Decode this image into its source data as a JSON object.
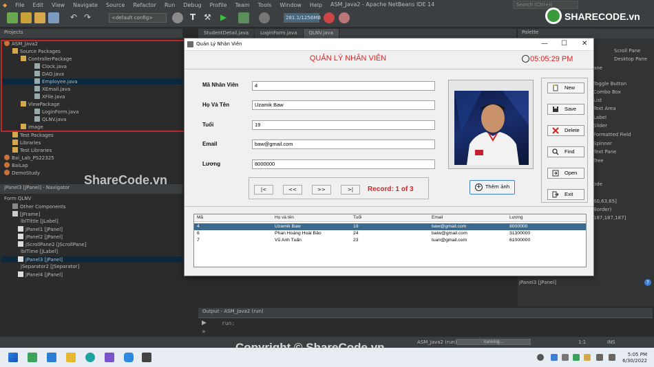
{
  "ide": {
    "title": "ASM_Java2 - Apache NetBeans IDE 14",
    "menu": [
      "File",
      "Edit",
      "View",
      "Navigate",
      "Source",
      "Refactor",
      "Run",
      "Debug",
      "Profile",
      "Team",
      "Tools",
      "Window",
      "Help"
    ],
    "search_placeholder": "Search (Ctrl+I)",
    "config": "<default config>",
    "memory": "281.1/1256MB",
    "projects_tab": "Projects",
    "project_tree": [
      "ASM_Java2",
      "Source Packages",
      "ControllerPackage",
      "Clock.java",
      "DAO.java",
      "Employee.java",
      "XEmail.java",
      "XFile.java",
      "ViewPackage",
      "LoginForm.java",
      "QLNV.java",
      "image",
      "Test Packages",
      "Libraries",
      "Test Libraries",
      "Bai_Lab_PS22325",
      "BaiLap",
      "DemoStudy"
    ],
    "navigator_tab": "jPanel3 [JPanel] - Navigator",
    "navigator_tree": [
      "Form QLNV",
      "Other Components",
      "[JFrame]",
      "lblTittle [JLabel]",
      "jPanel1 [JPanel]",
      "jPanel2 [JPanel]",
      "jScrollPane2 [JScrollPane]",
      "lblTime [JLabel]",
      "jPanel3 [JPanel]",
      "jSeparator2 [JSeparator]",
      "jPanel4 [JPanel]"
    ],
    "editor_tabs": [
      "StudentDetail.java",
      "LoginForm.java",
      "QLNV.java"
    ],
    "palette_tab": "Palette",
    "palette_items": [
      "Scroll Pane",
      "Desktop Pane",
      "ane",
      "Toggle Button",
      "Combo Box",
      "List",
      "Text Area",
      "Label",
      "Slider",
      "Formatted Field",
      "Spinner",
      "Text Pane",
      "Tree",
      "ode",
      "60,63,65]",
      "Border)",
      "187,187,187]",
      "jPanel3 [JPanel]"
    ],
    "output_tab": "Output - ASM_Java2 (run)",
    "output_text": "run:",
    "status_project": "ASM_Java2 (run)",
    "status_running": "running...",
    "status_pos": "1:1",
    "status_mode": "INS",
    "clock_time": "5:05 PM",
    "clock_date": "6/30/2022",
    "watermark_side": "ShareCode.vn",
    "watermark_bottom": "Copyright © ShareCode.vn",
    "logo_text": "SHARECODE.vn"
  },
  "app": {
    "window_title": "Quản Lý Nhân Viên",
    "heading": "QUẢN LÝ NHÂN VIÊN",
    "time": "05:05:29 PM",
    "fields": [
      {
        "label": "Mã Nhân Viên",
        "value": "4"
      },
      {
        "label": "Họ Và Tên",
        "value": "Uzamik Baw"
      },
      {
        "label": "Tuổi",
        "value": "19"
      },
      {
        "label": "Email",
        "value": "baw@gmail.com"
      },
      {
        "label": "Lương",
        "value": "8000000"
      }
    ],
    "nav": {
      "first": "|<",
      "prev": "<<",
      "next": ">>",
      "last": ">|"
    },
    "record": "Record: 1 of 3",
    "add_image": "Thêm ảnh",
    "actions": {
      "new": "New",
      "save": "Save",
      "delete": "Delete",
      "find": "Find",
      "open": "Open",
      "exit": "Exit"
    },
    "table": {
      "columns": [
        "Mã",
        "Họ và tên",
        "Tuổi",
        "Email",
        "Lương"
      ],
      "rows": [
        [
          "4",
          "Uzamik Baw",
          "19",
          "baw@gmail.com",
          "8000000"
        ],
        [
          "6",
          "Phan Hoàng Hoài Bảo",
          "24",
          "baiw@gmail.com",
          "31300000"
        ],
        [
          "7",
          "Vũ Anh Tuấn",
          "23",
          "tuan@gmail.com",
          "61000000"
        ]
      ],
      "selected_row": 0
    }
  }
}
